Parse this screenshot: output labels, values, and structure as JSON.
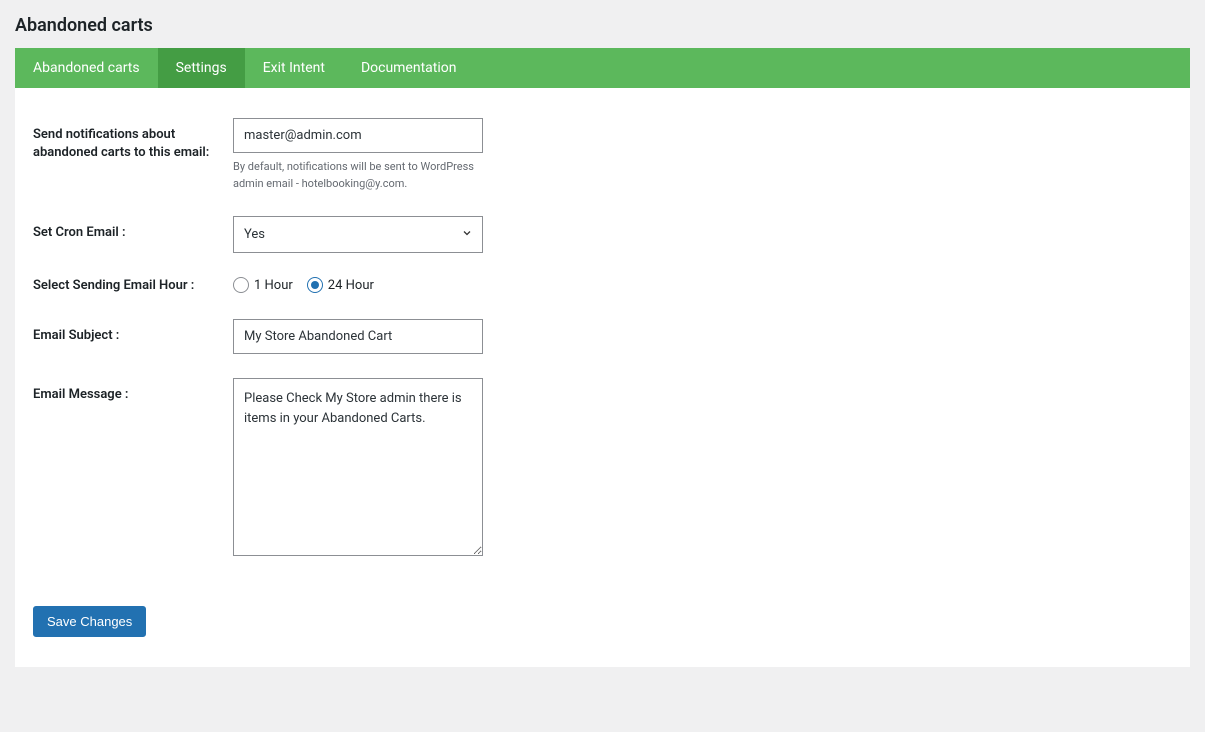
{
  "page": {
    "title": "Abandoned carts"
  },
  "tabs": [
    {
      "label": "Abandoned carts",
      "active": false
    },
    {
      "label": "Settings",
      "active": true
    },
    {
      "label": "Exit Intent",
      "active": false
    },
    {
      "label": "Documentation",
      "active": false
    }
  ],
  "form": {
    "notification_email": {
      "label": "Send notifications about abandoned carts to this email:",
      "value": "master@admin.com",
      "help": "By default, notifications will be sent to WordPress admin email - hotelbooking@y.com."
    },
    "cron_email": {
      "label": "Set Cron Email :",
      "selected": "Yes"
    },
    "sending_hour": {
      "label": "Select Sending Email Hour :",
      "options": [
        {
          "label": "1 Hour",
          "checked": false
        },
        {
          "label": "24 Hour",
          "checked": true
        }
      ]
    },
    "email_subject": {
      "label": "Email Subject :",
      "value": "My Store Abandoned Cart"
    },
    "email_message": {
      "label": "Email Message :",
      "value": "Please Check My Store admin there is items in your Abandoned Carts."
    },
    "save_label": "Save Changes"
  }
}
